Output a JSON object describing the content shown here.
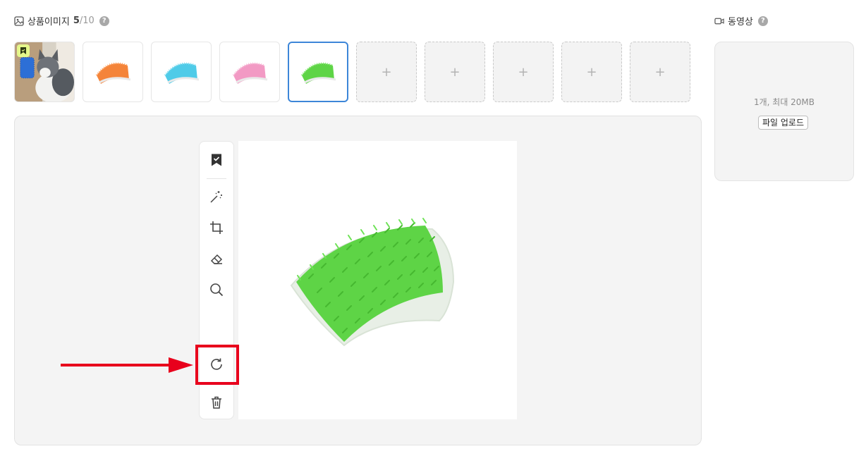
{
  "images_section": {
    "title": "상품이미지",
    "count_current": "5",
    "count_max": "/10",
    "help_icon": "?"
  },
  "thumbnails": [
    {
      "kind": "photo",
      "subject": "cat with blue brush",
      "representative": true
    },
    {
      "kind": "product",
      "color": "#f4843a"
    },
    {
      "kind": "product",
      "color": "#4fcbe8"
    },
    {
      "kind": "product",
      "color": "#f29ac4"
    },
    {
      "kind": "product",
      "color": "#5ed446",
      "selected": true
    },
    {
      "kind": "empty",
      "label": "+"
    },
    {
      "kind": "empty",
      "label": "+"
    },
    {
      "kind": "empty",
      "label": "+"
    },
    {
      "kind": "empty",
      "label": "+"
    },
    {
      "kind": "empty",
      "label": "+"
    }
  ],
  "editor": {
    "tools": [
      "bookmark-icon",
      "magic-wand-icon",
      "crop-icon",
      "eraser-icon",
      "zoom-icon",
      "rotate-icon",
      "trash-icon"
    ],
    "highlighted_tool": "rotate-icon",
    "preview_product_color": "#5ed446"
  },
  "video_section": {
    "title": "동영상",
    "help_icon": "?",
    "limit_text": "1개, 최대 20MB",
    "upload_label": "파일 업로드"
  },
  "colors": {
    "selected_border": "#3d86d8",
    "highlight": "#e8001c",
    "badge": "#e5f78a"
  }
}
